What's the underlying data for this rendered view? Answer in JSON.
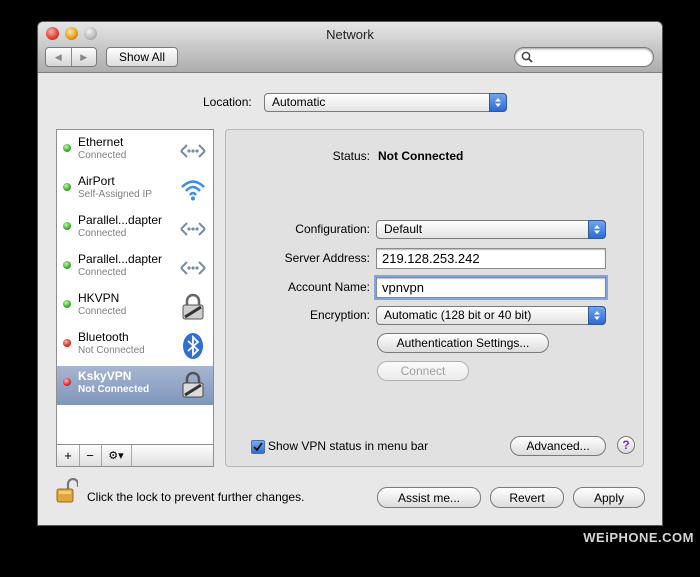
{
  "window": {
    "title": "Network"
  },
  "toolbar": {
    "show_all": "Show All",
    "search_placeholder": ""
  },
  "location": {
    "label": "Location:",
    "value": "Automatic"
  },
  "services": [
    {
      "name": "Ethernet",
      "status": "Connected",
      "state": "green",
      "icon": "ethernet-icon"
    },
    {
      "name": "AirPort",
      "status": "Self-Assigned IP",
      "state": "green",
      "icon": "wifi-icon"
    },
    {
      "name": "Parallel...dapter",
      "status": "Connected",
      "state": "green",
      "icon": "ethernet-icon"
    },
    {
      "name": "Parallel...dapter",
      "status": "Connected",
      "state": "green",
      "icon": "ethernet-icon"
    },
    {
      "name": "HKVPN",
      "status": "Connected",
      "state": "green",
      "icon": "vpn-lock-icon"
    },
    {
      "name": "Bluetooth",
      "status": "Not Connected",
      "state": "red",
      "icon": "bluetooth-icon"
    },
    {
      "name": "KskyVPN",
      "status": "Not Connected",
      "state": "red",
      "icon": "vpn-lock-icon",
      "selected": true
    }
  ],
  "sidebar_buttons": {
    "add": "+",
    "remove": "−",
    "action": "⚙▾"
  },
  "detail": {
    "status_label": "Status:",
    "status_value": "Not Connected",
    "configuration_label": "Configuration:",
    "configuration_value": "Default",
    "server_label": "Server Address:",
    "server_value": "219.128.253.242",
    "account_label": "Account Name:",
    "account_value": "vpnvpn",
    "encryption_label": "Encryption:",
    "encryption_value": "Automatic (128 bit or 40 bit)",
    "auth_button": "Authentication Settings...",
    "connect_button": "Connect",
    "show_vpn_label": "Show VPN status in menu bar",
    "advanced_button": "Advanced...",
    "help": "?"
  },
  "footer": {
    "lock_text": "Click the lock to prevent further changes.",
    "assist": "Assist me...",
    "revert": "Revert",
    "apply": "Apply"
  },
  "watermark": "WEiPHONE.COM"
}
